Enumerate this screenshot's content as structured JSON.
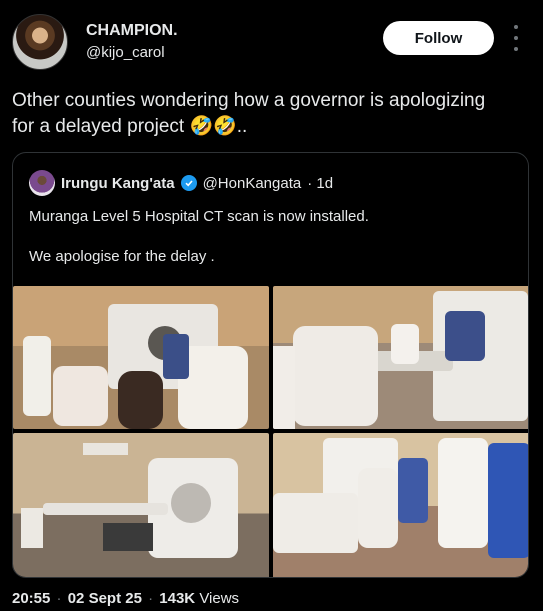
{
  "author": {
    "display_name": "CHAMPION.",
    "handle": "@kijo_carol",
    "follow_label": "Follow"
  },
  "post": {
    "text": "Other counties wondering how a governor is apologizing for a delayed project 🤣🤣.."
  },
  "quoted": {
    "name": "Irungu Kang'ata",
    "handle": "@HonKangata",
    "age": "· 1d",
    "line1": "Muranga Level 5 Hospital CT scan is now installed.",
    "line2": "We apologise for the delay ."
  },
  "meta": {
    "time": "20:55",
    "date": "02 Sept 25",
    "views_count": "143K",
    "views_label": "Views"
  },
  "icons": {
    "more": "more-horizontal-icon",
    "verified": "verified-badge-icon"
  },
  "colors": {
    "accent": "#1d9bf0",
    "background": "#000000"
  }
}
